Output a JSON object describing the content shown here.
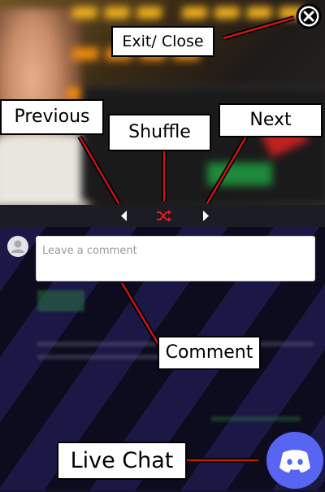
{
  "annotations": {
    "exit_close": "Exit/ Close",
    "previous": "Previous",
    "shuffle": "Shuffle",
    "next": "Next",
    "comment": "Comment",
    "live_chat": "Live Chat"
  },
  "comment": {
    "placeholder": "Leave a comment"
  },
  "icons": {
    "close": "close-icon",
    "previous": "previous-icon",
    "shuffle": "shuffle-icon",
    "next": "next-icon",
    "avatar": "user-avatar-icon",
    "live_chat": "discord-icon"
  },
  "colors": {
    "leader_line": "#c8141e",
    "shuffle_accent": "#e01b24",
    "discord": "#5865f2",
    "label_bg": "#ffffff"
  }
}
